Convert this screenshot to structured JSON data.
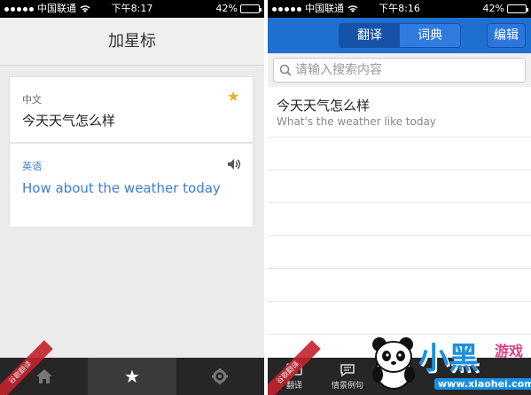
{
  "status": {
    "carrier": "中国联通",
    "left_time": "下午8:17",
    "right_time": "下午8:16",
    "battery": "42%",
    "battery_level": 0.42
  },
  "left": {
    "title": "加星标",
    "source_lang": "中文",
    "source_text": "今天天气怎么样",
    "target_lang": "英语",
    "target_text": "How about the weather today",
    "ribbon": "谷歌翻译"
  },
  "right": {
    "tabs": [
      "翻译",
      "词典"
    ],
    "active_tab": 0,
    "edit_label": "编辑",
    "search_placeholder": "请输入搜索内容",
    "history": [
      {
        "zh": "今天天气怎么样",
        "en": "What's the weather like today"
      }
    ],
    "bottom_tabs": [
      {
        "icon": "translate-icon",
        "label": "翻译"
      },
      {
        "icon": "chat-icon",
        "label": "情景例句"
      }
    ],
    "ribbon": "谷歌翻译"
  },
  "watermark": {
    "word": "小黑",
    "sub": "游戏",
    "url": "www.xiaohei.com"
  },
  "colors": {
    "blue_bar": "#1f6fd1",
    "star": "#e6b022",
    "link_blue": "#3b7dd8",
    "ribbon_red": "#c4222c"
  }
}
